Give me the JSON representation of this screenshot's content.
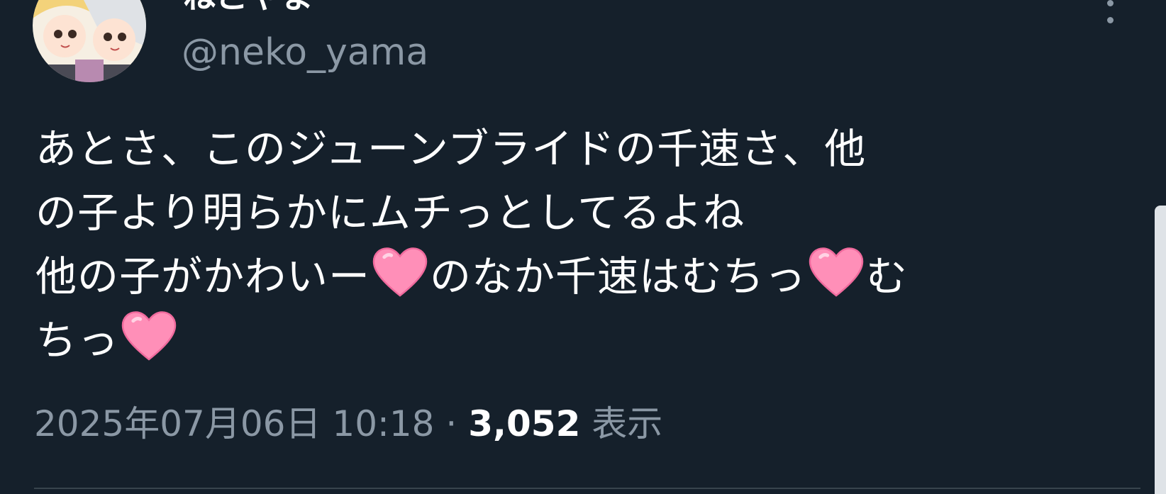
{
  "user": {
    "display_name": "ねこやま",
    "handle": "@neko_yama"
  },
  "tweet": {
    "lines": [
      [
        "あとさ、このジューンブライドの千速さ、他"
      ],
      [
        "の子より明らかにムチっとしてるよね"
      ],
      [
        "他の子がかわいー",
        "💗",
        "のなか千速はむちっ",
        "💗",
        "む"
      ],
      [
        "ちっ",
        "💗"
      ]
    ],
    "date": "2025年07月06日 10:18",
    "separator": "·",
    "views_count": "3,052",
    "views_label": "表示"
  },
  "colors": {
    "background": "#15202b",
    "primary_text": "#ffffff",
    "secondary_text": "#8b98a5",
    "heart": "#ff8fb8",
    "divider": "#38444d"
  },
  "icons": {
    "heart": "pink-heart-emoji-icon",
    "more": "more-vertical-icon"
  }
}
